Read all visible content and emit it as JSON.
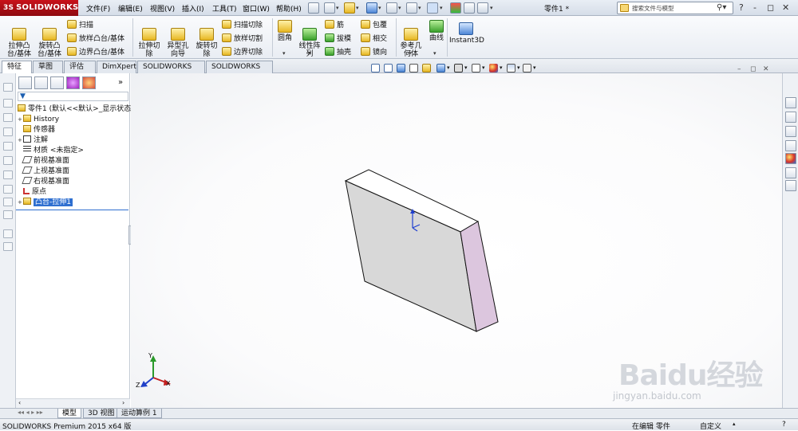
{
  "app": {
    "logo_text": "SOLIDWORKS",
    "logo_mark": "3S",
    "document_title": "零件1 *"
  },
  "menu": [
    "文件(F)",
    "编辑(E)",
    "视图(V)",
    "插入(I)",
    "工具(T)",
    "窗口(W)",
    "帮助(H)"
  ],
  "search": {
    "placeholder": "搜索文件与模型",
    "icon": "search-icon"
  },
  "window_controls": [
    "?",
    "-",
    "◻",
    "✕"
  ],
  "ribbon": {
    "extrude_boss": "拉伸凸\n台/基体",
    "revolve_boss": "旋转凸\n台/基体",
    "sweep": "扫描",
    "loft_boss": "放样凸台/基体",
    "boundary_boss": "边界凸台/基体",
    "extrude_cut": "拉伸切\n除",
    "hole_wizard": "异型孔\n向导",
    "revolve_cut": "旋转切\n除",
    "swept_cut": "扫描切除",
    "lofted_cut": "放样切割",
    "boundary_cut": "边界切除",
    "fillet": "圆角",
    "linear_pattern": "线性阵\n列",
    "rib": "筋",
    "draft": "拔模",
    "shell": "抽壳",
    "wrap": "包覆",
    "intersect": "相交",
    "mirror": "镜向",
    "ref_geometry": "参考几\n何体",
    "curves": "曲线",
    "instant3d": "Instant3D"
  },
  "tabs": [
    "特征",
    "草图",
    "评估",
    "DimXpert",
    "SOLIDWORKS 插件",
    "SOLIDWORKS MBD"
  ],
  "feature_tree": {
    "root": "零件1 (默认<<默认>_显示状态",
    "items": [
      "History",
      "传感器",
      "注解",
      "材质 <未指定>",
      "前视基准面",
      "上视基准面",
      "右视基准面",
      "原点",
      "凸台-拉伸1"
    ]
  },
  "bottom_tabs": [
    "模型",
    "3D 视图",
    "运动算例 1"
  ],
  "status": {
    "product": "SOLIDWORKS Premium 2015 x64 版",
    "editing": "在编辑 零件",
    "custom": "自定义"
  },
  "triad": {
    "x": "X",
    "y": "Y",
    "z": "Z"
  },
  "watermark": {
    "brand": "Baidu经验",
    "url": "jingyan.baidu.com"
  },
  "colors": {
    "accent_red": "#c8121a",
    "selection_blue": "#2f6fd0",
    "part_side": "#dcc6de",
    "part_front": "#d9d9d9"
  }
}
